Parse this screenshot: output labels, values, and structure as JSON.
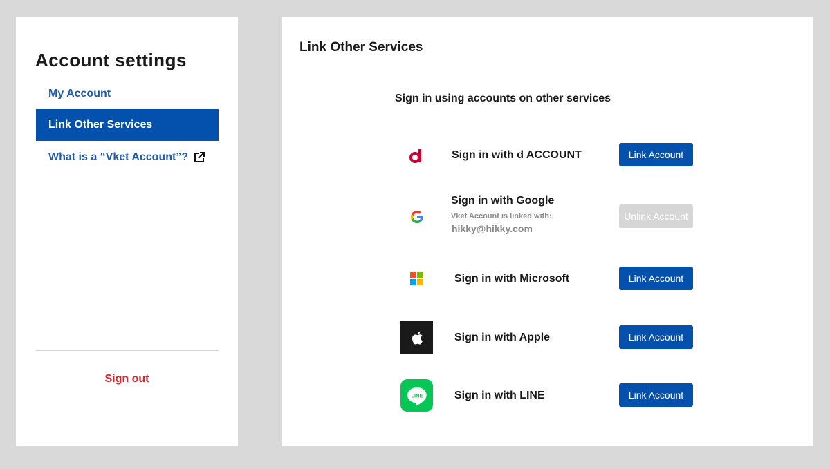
{
  "sidebar": {
    "title": "Account settings",
    "items": [
      {
        "label": "My Account"
      },
      {
        "label": "Link Other Services"
      },
      {
        "label": "What is a “Vket Account”?"
      }
    ],
    "signout_label": "Sign out"
  },
  "main": {
    "title": "Link Other Services",
    "subtitle": "Sign in using accounts on other services",
    "services": [
      {
        "icon": "d-account-icon",
        "label": "Sign in with d ACCOUNT",
        "button": "Link Account"
      },
      {
        "icon": "google-icon",
        "label": "Sign in with Google",
        "note": "Vket Account is linked with:",
        "email": "hikky@hikky.com",
        "button": "Unlink Account"
      },
      {
        "icon": "microsoft-icon",
        "label": "Sign in with Microsoft",
        "button": "Link Account"
      },
      {
        "icon": "apple-icon",
        "label": "Sign in with Apple",
        "button": "Link Account"
      },
      {
        "icon": "line-icon",
        "label": "Sign in with LINE",
        "button": "Link Account"
      }
    ]
  },
  "colors": {
    "accent": "#0451ad",
    "link": "#1e5aa8",
    "signout": "#e3232a",
    "disabled": "#d6d6d6",
    "d_account": "#cc0033",
    "line": "#06c755"
  }
}
